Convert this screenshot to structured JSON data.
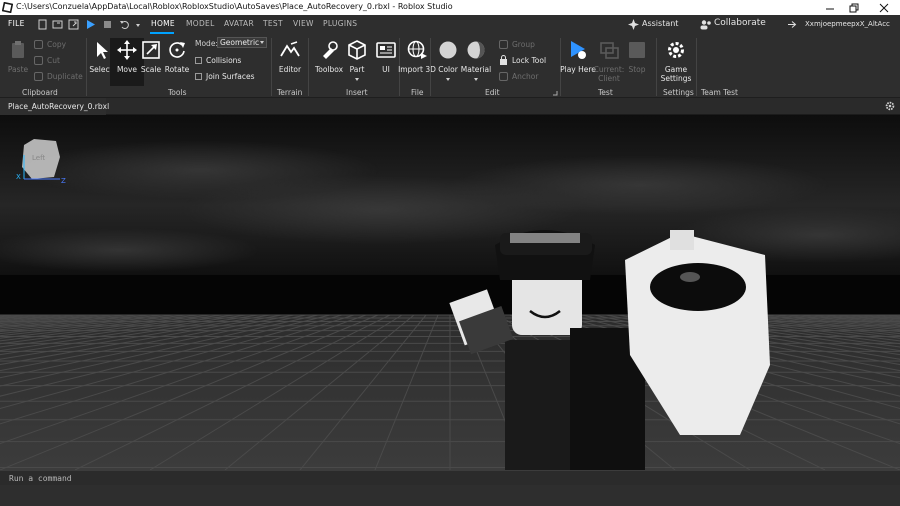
{
  "window": {
    "title": "C:\\Users\\Conzuela\\AppData\\Local\\Roblox\\RobloxStudio\\AutoSaves\\Place_AutoRecovery_0.rbxl - Roblox Studio",
    "controls": [
      "minimize-icon",
      "maximize-icon",
      "close-icon"
    ]
  },
  "menu": {
    "file": "FILE",
    "tabs": [
      {
        "label": "HOME",
        "active": true
      },
      {
        "label": "MODEL",
        "active": false
      },
      {
        "label": "AVATAR",
        "active": false
      },
      {
        "label": "TEST",
        "active": false
      },
      {
        "label": "VIEW",
        "active": false
      },
      {
        "label": "PLUGINS",
        "active": false
      }
    ],
    "assistant": "Assistant",
    "collaborate": "Collaborate",
    "username": "XxmjoepmeepxX_AltAcc"
  },
  "ribbon": {
    "clipboard": {
      "paste": "Paste",
      "copy": "Copy",
      "cut": "Cut",
      "duplicate": "Duplicate",
      "group_label": "Clipboard"
    },
    "tools": {
      "select": "Select",
      "move": "Move",
      "scale": "Scale",
      "rotate": "Rotate",
      "mode_label": "Mode:",
      "mode_value": "Geometric",
      "collisions": "Collisions",
      "join_surfaces": "Join Surfaces",
      "group_label": "Tools"
    },
    "terrain": {
      "editor": "Editor",
      "group_label": "Terrain"
    },
    "insert": {
      "toolbox": "Toolbox",
      "part": "Part",
      "ui": "UI",
      "group_label": "Insert"
    },
    "file": {
      "import3d": "Import 3D",
      "group_label": "File"
    },
    "edit": {
      "color": "Color",
      "material": "Material",
      "group": "Group",
      "lock_tool": "Lock Tool",
      "anchor": "Anchor",
      "group_label": "Edit"
    },
    "test": {
      "play_here": "Play Here",
      "current_client": "Current: Client",
      "stop": "Stop",
      "group_label": "Test"
    },
    "settings": {
      "game_settings": "Game Settings",
      "group_label": "Settings"
    },
    "team_test": {
      "group_label": "Team Test"
    }
  },
  "document": {
    "tab_label": "Place_AutoRecovery_0.rbxl"
  },
  "view_cube": {
    "face": "Left",
    "axis_x": "X",
    "axis_z": "Z"
  },
  "command_bar": {
    "placeholder": "Run a command"
  },
  "colors": {
    "accent": "#00a2ff",
    "chrome": "#2e2e2e",
    "titlebar": "#ffffff"
  }
}
